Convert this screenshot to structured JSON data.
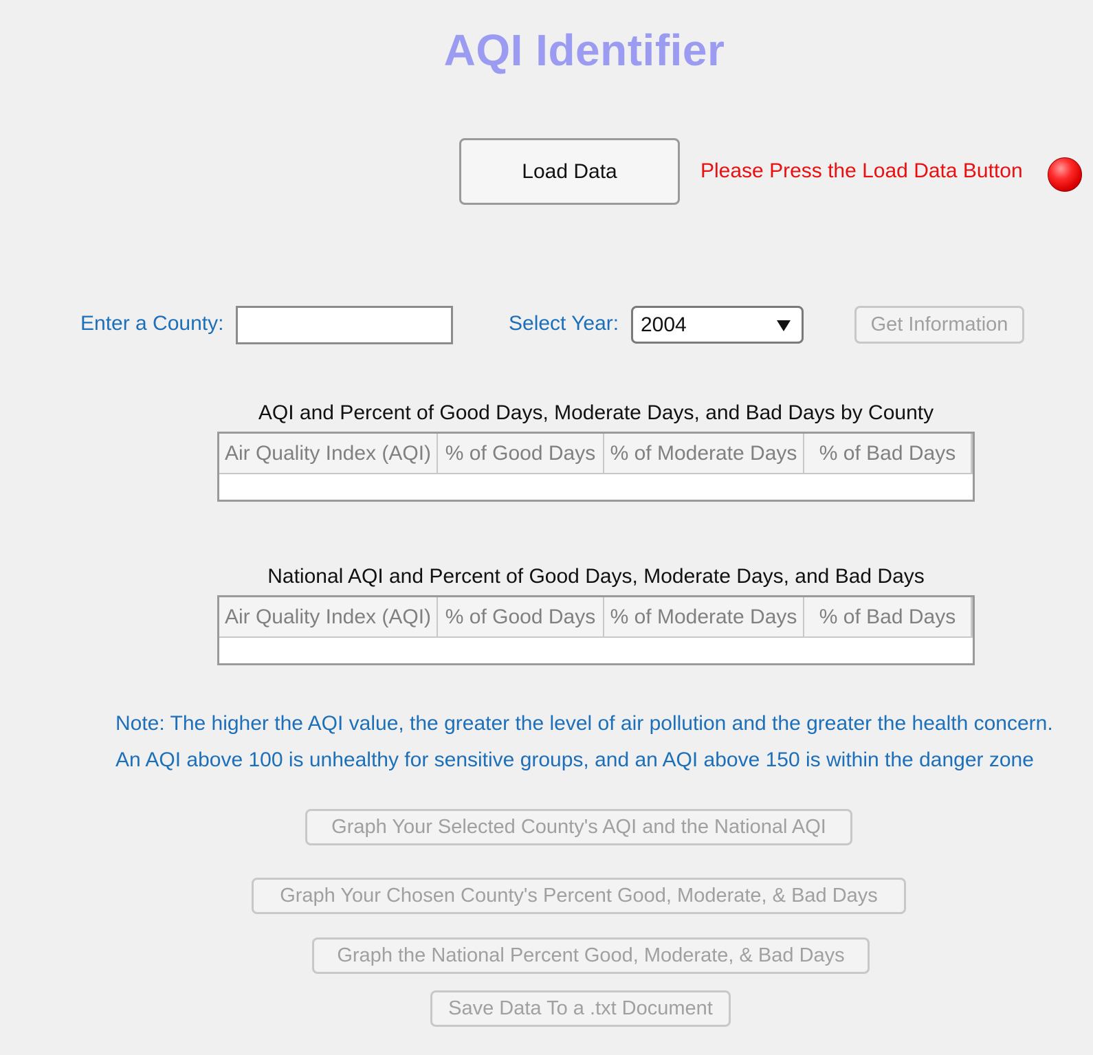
{
  "app": {
    "title": "AQI Identifier"
  },
  "load": {
    "button_label": "Load Data",
    "status_text": "Please Press the Load Data Button",
    "status_color": "#e81010",
    "lamp_color": "#ff2a2a"
  },
  "inputs": {
    "county_label": "Enter a County:",
    "county_value": "",
    "year_label": "Select Year:",
    "year_selected": "2004",
    "get_info_label": "Get Information"
  },
  "county_table": {
    "caption": "AQI and Percent of Good Days, Moderate Days, and Bad Days by County",
    "columns": [
      "Air Quality Index (AQI)",
      "% of Good Days",
      "% of Moderate Days",
      "% of Bad Days"
    ],
    "rows": []
  },
  "national_table": {
    "caption": "National AQI and Percent of Good Days, Moderate Days, and Bad Days",
    "columns": [
      "Air Quality Index (AQI)",
      "% of Good Days",
      "% of Moderate Days",
      "% of Bad Days"
    ],
    "rows": []
  },
  "note": {
    "line1": "Note: The higher the AQI value, the greater the level of air pollution and the greater the health concern.",
    "line2": "An AQI above 100 is unhealthy for sensitive groups, and an AQI above 150 is within the danger zone"
  },
  "actions": {
    "graph_county_vs_national": "Graph Your Selected County's AQI and the National AQI",
    "graph_county_percent": "Graph Your Chosen County's Percent Good, Moderate, & Bad Days",
    "graph_national_percent": "Graph the National Percent Good, Moderate, & Bad Days",
    "save_txt": "Save Data To a .txt Document"
  },
  "colors": {
    "background": "#f0f0f0",
    "title": "#9b9bf2",
    "label_blue": "#1c6fb8",
    "disabled_text": "#a0a0a0"
  }
}
